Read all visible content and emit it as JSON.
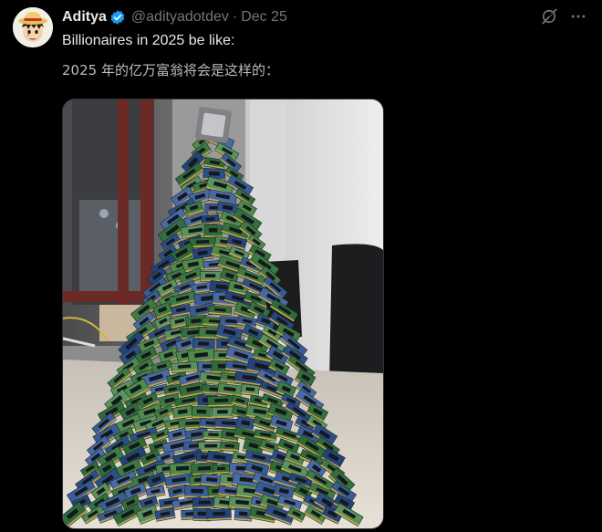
{
  "tweet": {
    "author": {
      "display_name": "Aditya",
      "handle": "@adityadotdev",
      "avatar_icon": "avatar-straw-hat-icon",
      "verified_icon": "verified-badge-icon",
      "verified_color": "#1d9bf0"
    },
    "separator": "·",
    "date": "Dec 25",
    "text_en": "Billionaires in 2025 be like:",
    "text_zh": "2025 年的亿万富翁将会是这样的：",
    "actions": {
      "grok_icon": "grok-icon",
      "more_icon": "more-dots-icon"
    },
    "media": {
      "description_icon": "tree-of-ram-sticks-photo"
    }
  },
  "colors": {
    "background": "#000000",
    "primary_text": "#e7e9ea",
    "secondary_text": "#71767b",
    "accent": "#1d9bf0",
    "border": "#2f3336"
  }
}
